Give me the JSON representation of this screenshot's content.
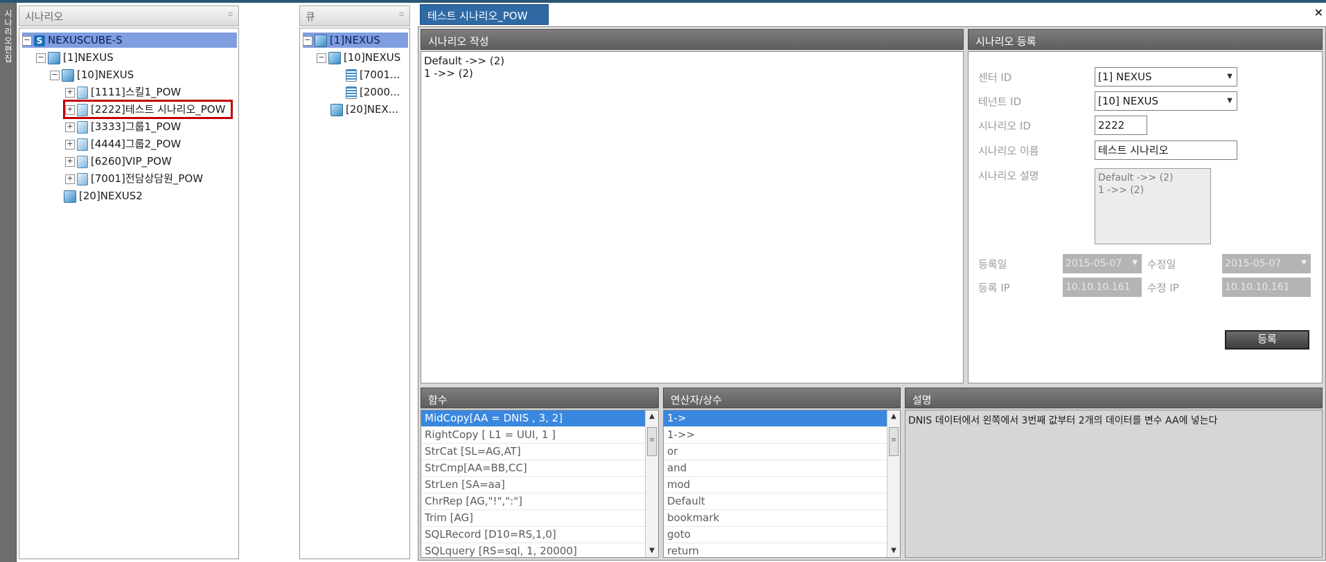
{
  "sidebar_tab": "시나리오 편집",
  "tree_panel": {
    "title": "시나리오",
    "items": [
      {
        "label": "NEXUSCUBE-S"
      },
      {
        "label": "[1]NEXUS"
      },
      {
        "label": "[10]NEXUS"
      },
      {
        "label": "[1111]스킬1_POW"
      },
      {
        "label": "[2222]테스트 시나리오_POW"
      },
      {
        "label": "[3333]그룹1_POW"
      },
      {
        "label": "[4444]그룹2_POW"
      },
      {
        "label": "[6260]VIP_POW"
      },
      {
        "label": "[7001]전담상담원_POW"
      },
      {
        "label": "[20]NEXUS2"
      }
    ]
  },
  "queue_panel": {
    "title": "큐",
    "items": [
      {
        "label": "[1]NEXUS"
      },
      {
        "label": "[10]NEXUS"
      },
      {
        "label": "[7001..."
      },
      {
        "label": "[2000..."
      },
      {
        "label": "[20]NEX..."
      }
    ]
  },
  "document_tab": {
    "label": "테스트 시나리오_POW",
    "close": "×"
  },
  "editor": {
    "title": "시나리오 작성",
    "lines": [
      "Default ->> (2)",
      "1 ->> (2)"
    ]
  },
  "register": {
    "title": "시나리오 등록",
    "center_label": "센터 ID",
    "center_value": "[1] NEXUS",
    "tenant_label": "테넌트 ID",
    "tenant_value": "[10] NEXUS",
    "scenario_id_label": "시나리오 ID",
    "scenario_id_value": "2222",
    "scenario_name_label": "시나리오 이름",
    "scenario_name_value": "테스트 시나리오",
    "scenario_desc_label": "시나리오 설명",
    "desc_lines": [
      "Default ->> (2)",
      "1 ->> (2)"
    ],
    "reg_date_label": "등록일",
    "reg_date_value": "2015-05-07",
    "mod_date_label": "수정일",
    "mod_date_value": "2015-05-07",
    "reg_ip_label": "등록 IP",
    "reg_ip_value": "10.10.10.161",
    "mod_ip_label": "수정 IP",
    "mod_ip_value": "10.10.10.161",
    "submit": "등록"
  },
  "functions": {
    "title": "함수",
    "items": [
      "MidCopy[AA = DNIS , 3, 2]",
      "RightCopy [ L1 = UUI, 1 ]",
      "StrCat [SL=AG,AT]",
      "StrCmp[AA=BB,CC]",
      "StrLen [SA=aa]",
      "ChrRep [AG,\"!\",\":\"]",
      "Trim [AG]",
      "SQLRecord [D10=RS,1,0]",
      "SQLquery [RS=sql, 1, 20000]"
    ]
  },
  "operators": {
    "title": "연산자/상수",
    "items": [
      "1->",
      "1->>",
      "or",
      "and",
      "mod",
      "Default",
      "bookmark",
      "goto",
      "return"
    ]
  },
  "description": {
    "title": "설명",
    "text": "DNIS 데이터에서 왼쪽에서 3번째 값부터 2개의 데이터를 변수 AA에 넣는다"
  },
  "colors": {
    "accent": "#2f6aa5",
    "selection": "#7f9ee0",
    "highlight_box": "#c00000"
  }
}
